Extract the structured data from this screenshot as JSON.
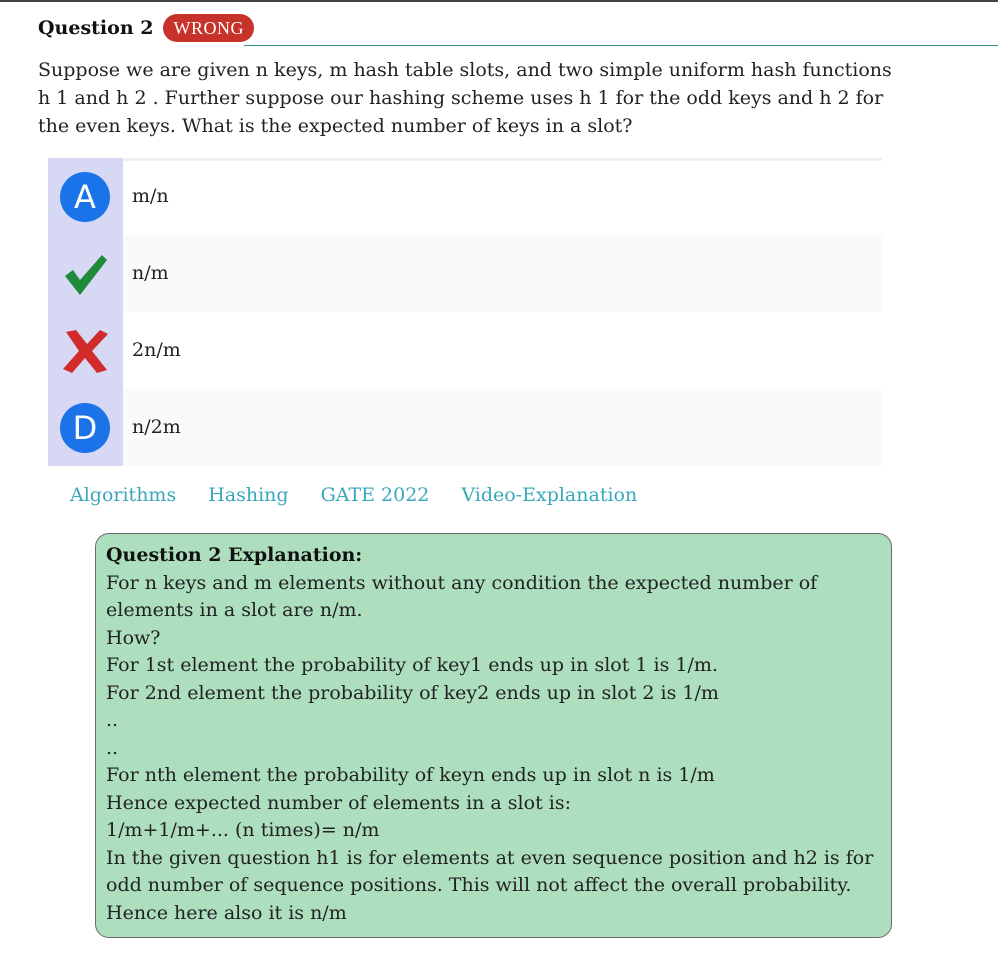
{
  "question": {
    "title": "Question 2",
    "status": "WRONG",
    "text": "Suppose we are given n keys, m hash table slots, and two simple uniform hash functions h 1 and h 2 . Further suppose our hashing scheme uses h 1 for the odd keys and h 2 for the even keys. What is the expected number of keys in a slot?"
  },
  "options": [
    {
      "marker": "A",
      "text": "m/n",
      "state": "neutral"
    },
    {
      "marker": "check",
      "text": "n/m",
      "state": "correct"
    },
    {
      "marker": "cross",
      "text": "2n/m",
      "state": "wrong"
    },
    {
      "marker": "D",
      "text": "n/2m",
      "state": "neutral"
    }
  ],
  "tags": [
    "Algorithms",
    "Hashing",
    "GATE 2022",
    "Video-Explanation"
  ],
  "explanation": {
    "title": "Question 2 Explanation:",
    "lines": [
      "For n keys and m elements without any condition the expected number of elements in a slot are n/m.",
      "How?",
      "For 1st element the probability of key1 ends up in slot 1 is 1/m.",
      "For 2nd element the probability of key2 ends up in slot 2 is 1/m",
      "..",
      "..",
      "For nth element the probability of keyn ends up in slot n is 1/m",
      "Hence expected number of elements in a slot is:",
      "1/m+1/m+... (n times)= n/m",
      "In the given question h1 is for elements at even sequence position and h2 is for odd number of sequence positions. This will not affect the overall probability.",
      "Hence here also it is n/m"
    ]
  },
  "colors": {
    "badge": "#c7322a",
    "option_circle": "#1a73e8",
    "check": "#1e8a3a",
    "cross": "#d22b2b",
    "tags": "#3aa7bd",
    "explanation_bg": "#addfbf"
  }
}
